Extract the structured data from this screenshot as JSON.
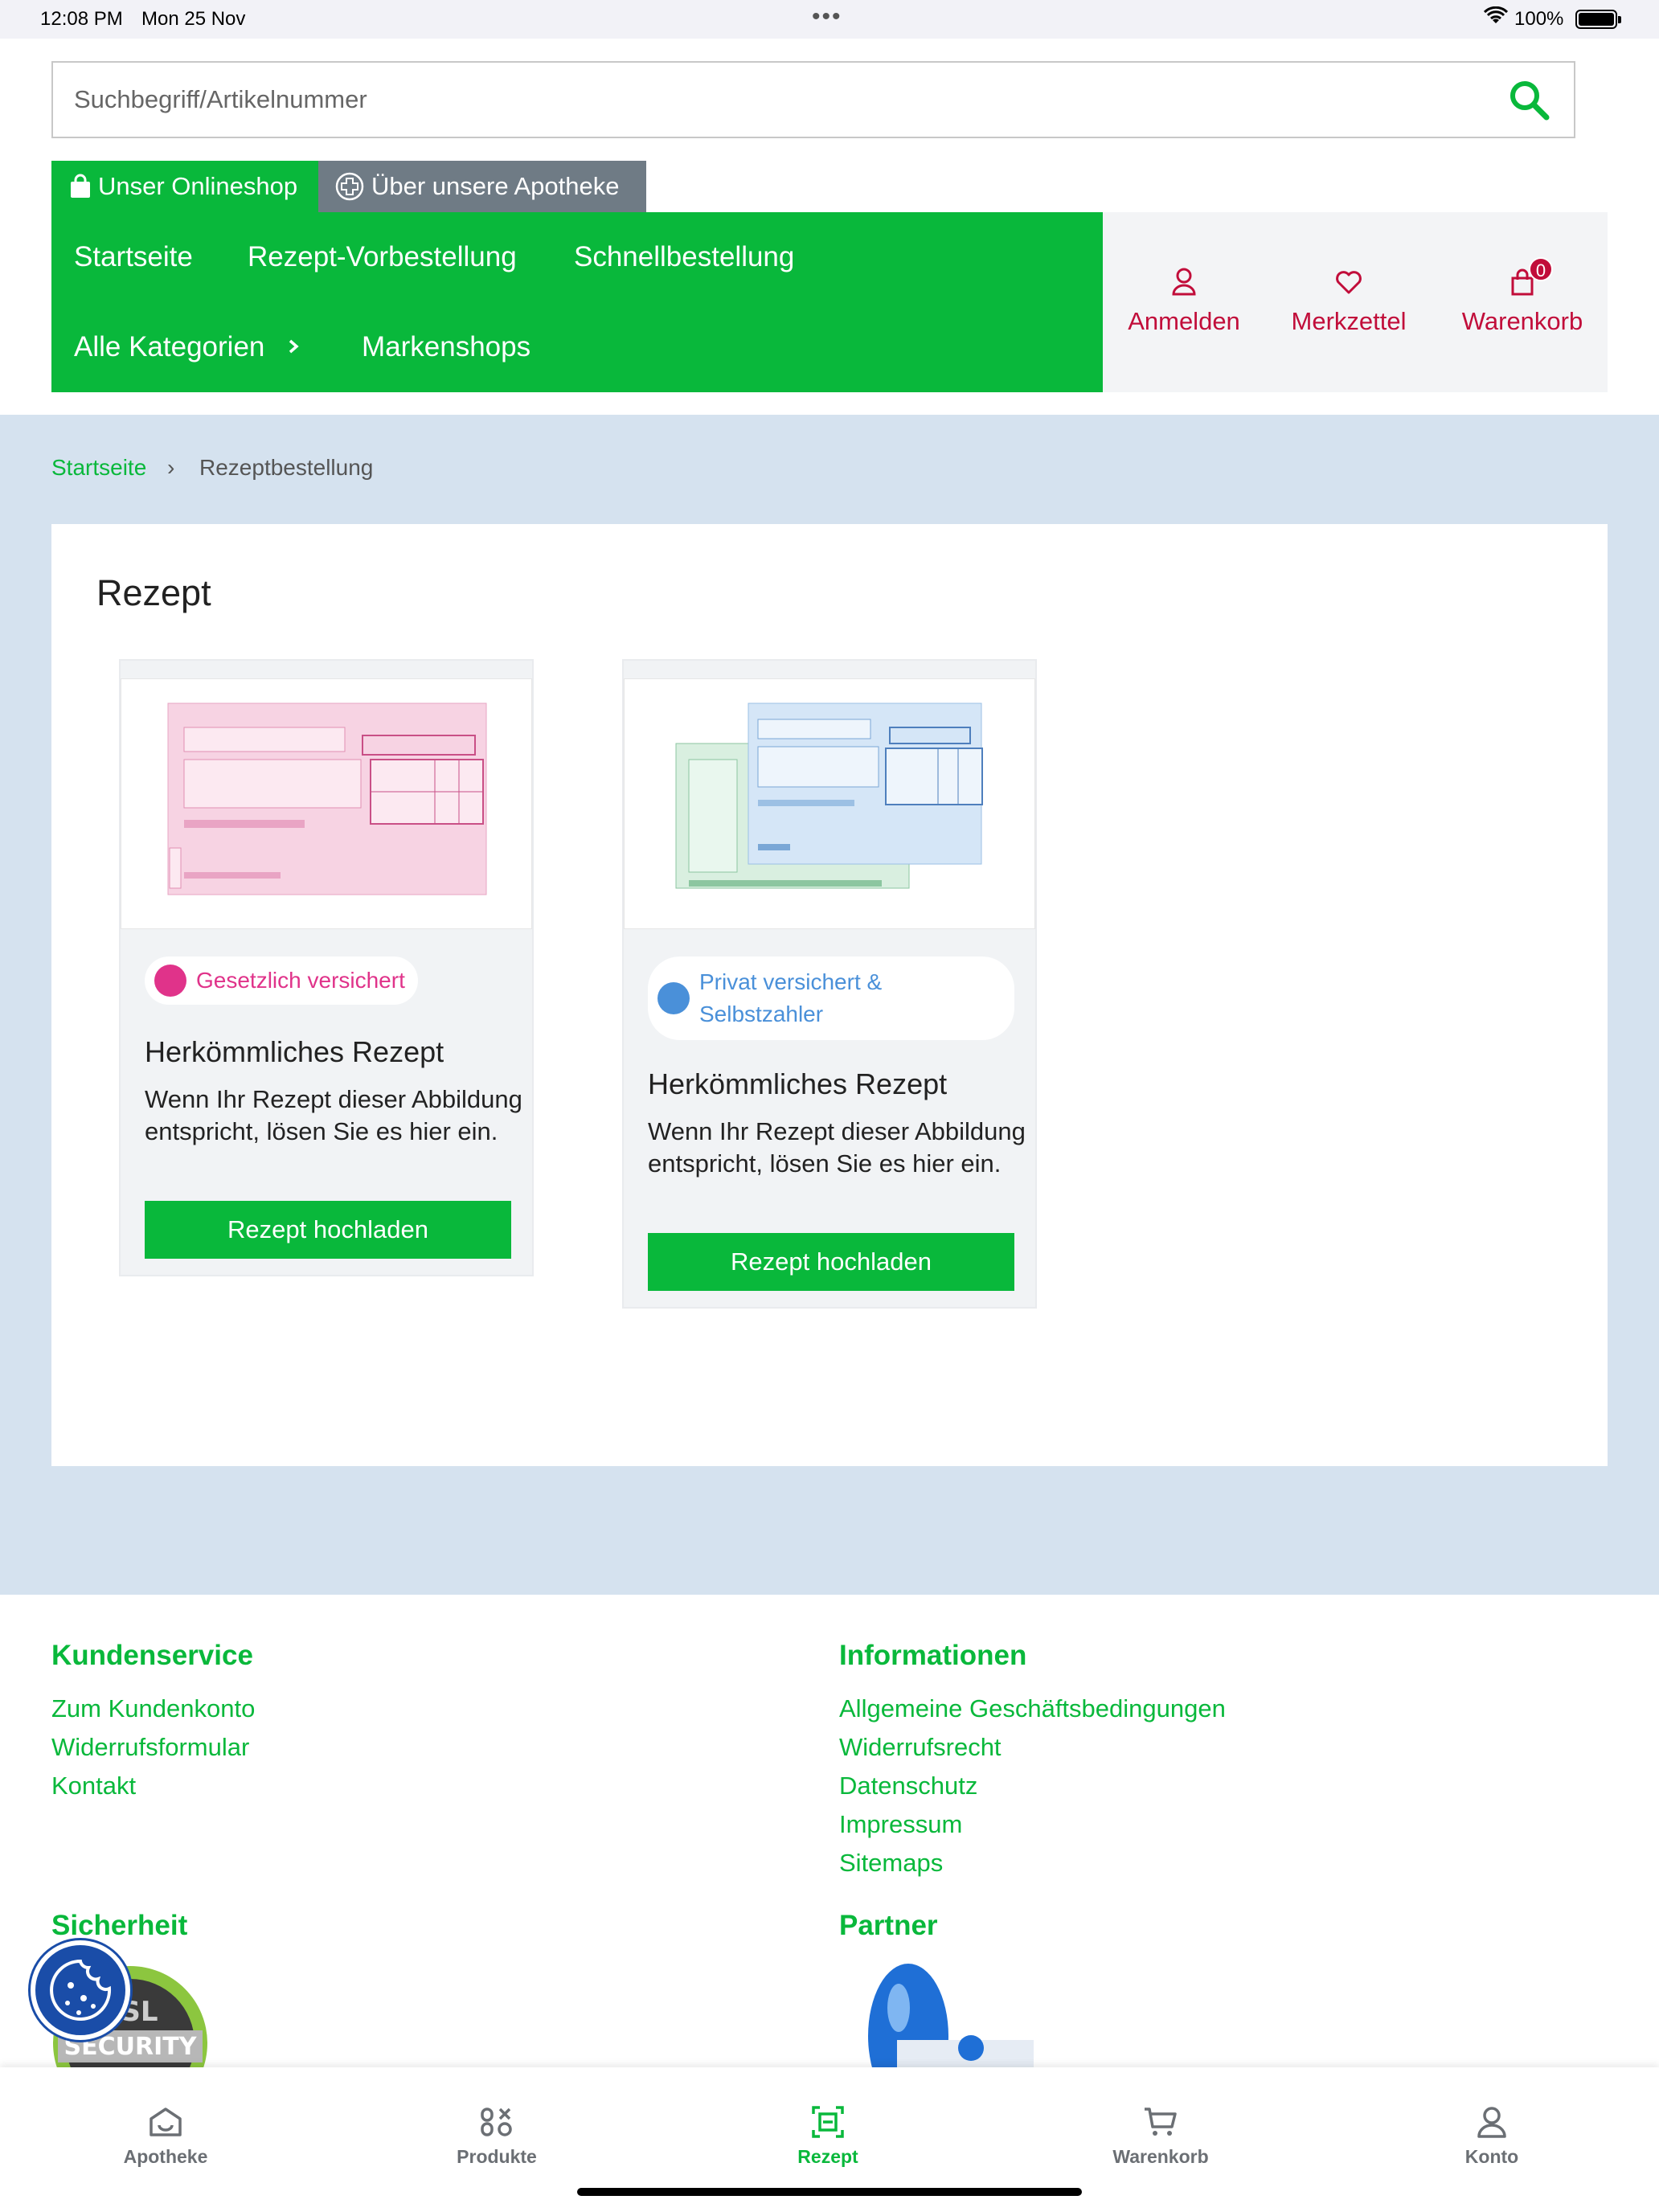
{
  "status_bar": {
    "time": "12:08 PM",
    "date": "Mon 25 Nov",
    "battery": "100%"
  },
  "search": {
    "placeholder": "Suchbegriff/Artikelnummer"
  },
  "shop_tabs": {
    "onlineshop": "Unser Onlineshop",
    "apotheke": "Über unsere Apotheke"
  },
  "nav": {
    "startseite": "Startseite",
    "rezept_vorbestellung": "Rezept-Vorbestellung",
    "schnellbestellung": "Schnellbestellung",
    "alle_kategorien": "Alle Kategorien",
    "markenshops": "Markenshops"
  },
  "account": {
    "anmelden": "Anmelden",
    "merkzettel": "Merkzettel",
    "warenkorb": "Warenkorb",
    "cart_count": "0"
  },
  "breadcrumb": {
    "home": "Startseite",
    "separator": "›",
    "current": "Rezeptbestellung"
  },
  "page": {
    "title": "Rezept"
  },
  "cards": [
    {
      "badge": "Gesetzlich versichert",
      "badge_color": "#e0338a",
      "title": "Herkömmliches Rezept",
      "text": "Wenn Ihr Rezept dieser Abbildung entspricht, lösen Sie es hier ein.",
      "button": "Rezept hochladen"
    },
    {
      "badge": "Privat versichert & Selbstzahler",
      "badge_color": "#4a90d9",
      "title": "Herkömmliches Rezept",
      "text": "Wenn Ihr Rezept dieser Abbildung entspricht, lösen Sie es hier ein.",
      "button": "Rezept hochladen"
    }
  ],
  "footer": {
    "kundenservice": {
      "heading": "Kundenservice",
      "links": [
        "Zum Kundenkonto",
        "Widerrufsformular",
        "Kontakt"
      ]
    },
    "informationen": {
      "heading": "Informationen",
      "links": [
        "Allgemeine Geschäftsbedingungen",
        "Widerrufsrecht",
        "Datenschutz",
        "Impressum",
        "Sitemaps"
      ]
    },
    "sicherheit": {
      "heading": "Sicherheit",
      "seal_text": "SSL SECURITY"
    },
    "partner": {
      "heading": "Partner"
    }
  },
  "tabbar": {
    "apotheke": "Apotheke",
    "produkte": "Produkte",
    "rezept": "Rezept",
    "warenkorb": "Warenkorb",
    "konto": "Konto"
  },
  "colors": {
    "brand_green": "#09b83b",
    "account_red": "#c10d3a",
    "background_blue": "#d5e2ef"
  }
}
